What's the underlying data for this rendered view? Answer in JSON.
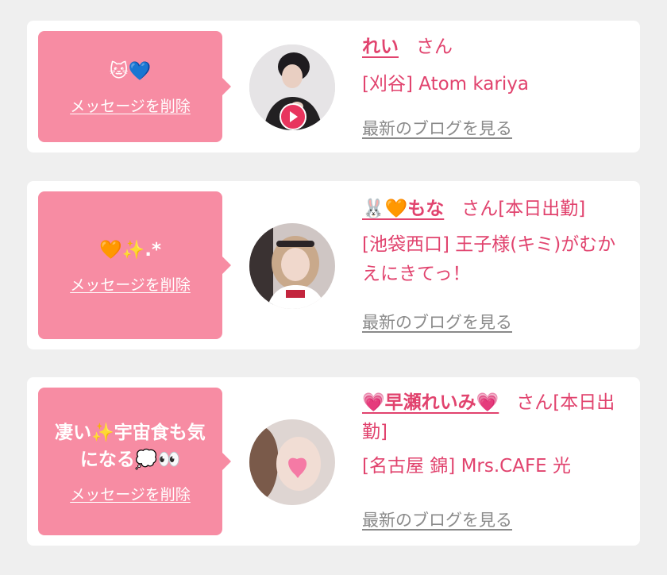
{
  "entries": [
    {
      "message": "🐱💙",
      "delete_label": "メッセージを削除",
      "name": "れい",
      "honorific": "さん",
      "shop": "[刈谷] Atom kariya",
      "blog_label": "最新のブログを見る"
    },
    {
      "message": "🧡✨.*",
      "delete_label": "メッセージを削除",
      "name": "🐰🧡もな",
      "honorific": "さん[本日出勤]",
      "shop": "[池袋西口] 王子様(キミ)がむかえにきてっ！",
      "blog_label": "最新のブログを見る"
    },
    {
      "message": "凄い✨宇宙食も気になる💭👀",
      "delete_label": "メッセージを削除",
      "name": "💗早瀬れいみ💗",
      "honorific": "さん[本日出勤]",
      "shop": "[名古屋 錦] Mrs.CAFE 光",
      "blog_label": "最新のブログを見る"
    }
  ],
  "colors": {
    "bubble": "#f78ca3",
    "accent_text": "#e1436e",
    "link_gray": "#8a8a8a",
    "page_bg": "#efefef"
  }
}
